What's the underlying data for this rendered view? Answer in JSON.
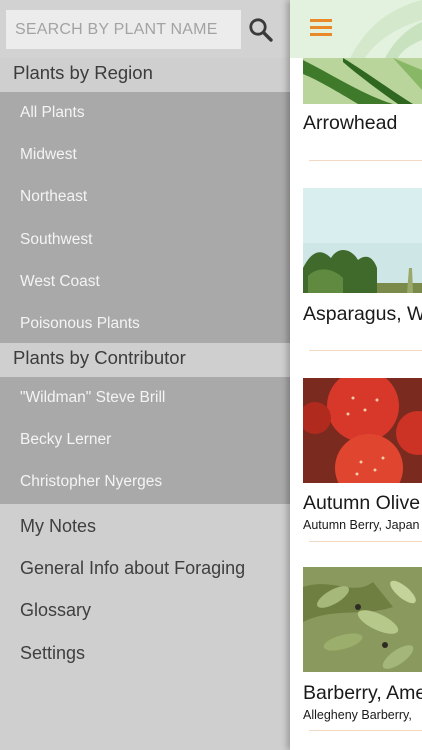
{
  "search": {
    "placeholder": "SEARCH BY PLANT NAME"
  },
  "menu": {
    "region_heading": "Plants by Region",
    "region_items": [
      "All Plants",
      "Midwest",
      "Northeast",
      "Southwest",
      "West Coast",
      "Poisonous Plants"
    ],
    "contributor_heading": "Plants by Contributor",
    "contributor_items": [
      "\"Wildman\" Steve Brill",
      "Becky Lerner",
      "Christopher Nyerges"
    ],
    "main_items": [
      "My Notes",
      "General Info about Foraging",
      "Glossary",
      "Settings"
    ]
  },
  "plants": [
    {
      "name": "Arrowhead",
      "aka": ""
    },
    {
      "name": "Asparagus, W",
      "aka": ""
    },
    {
      "name": "Autumn Olive",
      "aka": "Autumn Berry, Japan"
    },
    {
      "name": "Barberry, Ame",
      "aka": "Allegheny Barberry, "
    }
  ],
  "colors": {
    "accent": "#e88a2a",
    "menu_bg": "#cfcfcf",
    "submenu_bg": "#a9a9a9"
  }
}
